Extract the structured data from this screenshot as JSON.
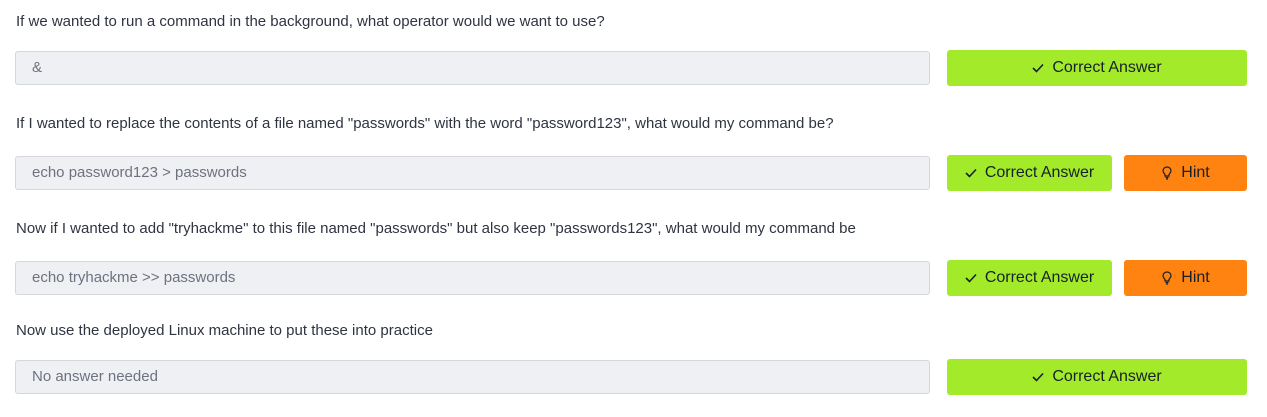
{
  "questions": [
    {
      "text": "If we wanted to run a command in the background, what operator would we want to use?",
      "answer": "&",
      "correct_label": "Correct Answer",
      "hint_label": null
    },
    {
      "text": "If I wanted to replace the contents of a file named \"passwords\" with the word \"password123\", what would my command be?",
      "answer": "echo password123 > passwords",
      "correct_label": "Correct Answer",
      "hint_label": "Hint"
    },
    {
      "text": "Now if I wanted to add \"tryhackme\" to this file named \"passwords\" but also keep \"passwords123\", what would my command be",
      "answer": "echo tryhackme >> passwords",
      "correct_label": "Correct Answer",
      "hint_label": "Hint"
    },
    {
      "text": "Now use the deployed Linux machine to put these into practice",
      "answer": "No answer needed",
      "correct_label": "Correct Answer",
      "hint_label": null
    }
  ],
  "icons": {
    "check": "check-icon",
    "hint": "lightbulb-icon"
  },
  "colors": {
    "correct_button": "#a3ea2a",
    "hint_button": "#ff8310",
    "field_background": "#eff0f3"
  }
}
